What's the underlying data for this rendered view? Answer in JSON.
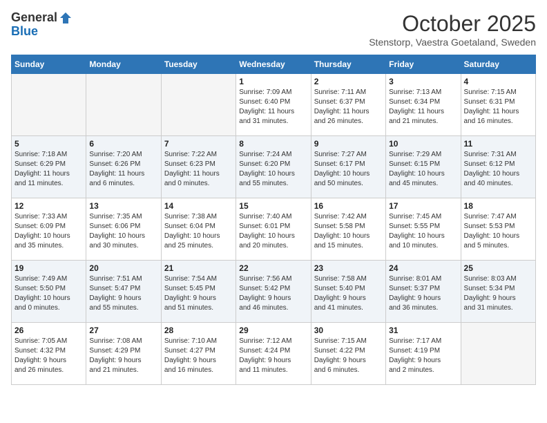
{
  "logo": {
    "general": "General",
    "blue": "Blue"
  },
  "title": "October 2025",
  "location": "Stenstorp, Vaestra Goetaland, Sweden",
  "weekdays": [
    "Sunday",
    "Monday",
    "Tuesday",
    "Wednesday",
    "Thursday",
    "Friday",
    "Saturday"
  ],
  "weeks": [
    [
      {
        "day": "",
        "info": ""
      },
      {
        "day": "",
        "info": ""
      },
      {
        "day": "",
        "info": ""
      },
      {
        "day": "1",
        "info": "Sunrise: 7:09 AM\nSunset: 6:40 PM\nDaylight: 11 hours\nand 31 minutes."
      },
      {
        "day": "2",
        "info": "Sunrise: 7:11 AM\nSunset: 6:37 PM\nDaylight: 11 hours\nand 26 minutes."
      },
      {
        "day": "3",
        "info": "Sunrise: 7:13 AM\nSunset: 6:34 PM\nDaylight: 11 hours\nand 21 minutes."
      },
      {
        "day": "4",
        "info": "Sunrise: 7:15 AM\nSunset: 6:31 PM\nDaylight: 11 hours\nand 16 minutes."
      }
    ],
    [
      {
        "day": "5",
        "info": "Sunrise: 7:18 AM\nSunset: 6:29 PM\nDaylight: 11 hours\nand 11 minutes."
      },
      {
        "day": "6",
        "info": "Sunrise: 7:20 AM\nSunset: 6:26 PM\nDaylight: 11 hours\nand 6 minutes."
      },
      {
        "day": "7",
        "info": "Sunrise: 7:22 AM\nSunset: 6:23 PM\nDaylight: 11 hours\nand 0 minutes."
      },
      {
        "day": "8",
        "info": "Sunrise: 7:24 AM\nSunset: 6:20 PM\nDaylight: 10 hours\nand 55 minutes."
      },
      {
        "day": "9",
        "info": "Sunrise: 7:27 AM\nSunset: 6:17 PM\nDaylight: 10 hours\nand 50 minutes."
      },
      {
        "day": "10",
        "info": "Sunrise: 7:29 AM\nSunset: 6:15 PM\nDaylight: 10 hours\nand 45 minutes."
      },
      {
        "day": "11",
        "info": "Sunrise: 7:31 AM\nSunset: 6:12 PM\nDaylight: 10 hours\nand 40 minutes."
      }
    ],
    [
      {
        "day": "12",
        "info": "Sunrise: 7:33 AM\nSunset: 6:09 PM\nDaylight: 10 hours\nand 35 minutes."
      },
      {
        "day": "13",
        "info": "Sunrise: 7:35 AM\nSunset: 6:06 PM\nDaylight: 10 hours\nand 30 minutes."
      },
      {
        "day": "14",
        "info": "Sunrise: 7:38 AM\nSunset: 6:04 PM\nDaylight: 10 hours\nand 25 minutes."
      },
      {
        "day": "15",
        "info": "Sunrise: 7:40 AM\nSunset: 6:01 PM\nDaylight: 10 hours\nand 20 minutes."
      },
      {
        "day": "16",
        "info": "Sunrise: 7:42 AM\nSunset: 5:58 PM\nDaylight: 10 hours\nand 15 minutes."
      },
      {
        "day": "17",
        "info": "Sunrise: 7:45 AM\nSunset: 5:55 PM\nDaylight: 10 hours\nand 10 minutes."
      },
      {
        "day": "18",
        "info": "Sunrise: 7:47 AM\nSunset: 5:53 PM\nDaylight: 10 hours\nand 5 minutes."
      }
    ],
    [
      {
        "day": "19",
        "info": "Sunrise: 7:49 AM\nSunset: 5:50 PM\nDaylight: 10 hours\nand 0 minutes."
      },
      {
        "day": "20",
        "info": "Sunrise: 7:51 AM\nSunset: 5:47 PM\nDaylight: 9 hours\nand 55 minutes."
      },
      {
        "day": "21",
        "info": "Sunrise: 7:54 AM\nSunset: 5:45 PM\nDaylight: 9 hours\nand 51 minutes."
      },
      {
        "day": "22",
        "info": "Sunrise: 7:56 AM\nSunset: 5:42 PM\nDaylight: 9 hours\nand 46 minutes."
      },
      {
        "day": "23",
        "info": "Sunrise: 7:58 AM\nSunset: 5:40 PM\nDaylight: 9 hours\nand 41 minutes."
      },
      {
        "day": "24",
        "info": "Sunrise: 8:01 AM\nSunset: 5:37 PM\nDaylight: 9 hours\nand 36 minutes."
      },
      {
        "day": "25",
        "info": "Sunrise: 8:03 AM\nSunset: 5:34 PM\nDaylight: 9 hours\nand 31 minutes."
      }
    ],
    [
      {
        "day": "26",
        "info": "Sunrise: 7:05 AM\nSunset: 4:32 PM\nDaylight: 9 hours\nand 26 minutes."
      },
      {
        "day": "27",
        "info": "Sunrise: 7:08 AM\nSunset: 4:29 PM\nDaylight: 9 hours\nand 21 minutes."
      },
      {
        "day": "28",
        "info": "Sunrise: 7:10 AM\nSunset: 4:27 PM\nDaylight: 9 hours\nand 16 minutes."
      },
      {
        "day": "29",
        "info": "Sunrise: 7:12 AM\nSunset: 4:24 PM\nDaylight: 9 hours\nand 11 minutes."
      },
      {
        "day": "30",
        "info": "Sunrise: 7:15 AM\nSunset: 4:22 PM\nDaylight: 9 hours\nand 6 minutes."
      },
      {
        "day": "31",
        "info": "Sunrise: 7:17 AM\nSunset: 4:19 PM\nDaylight: 9 hours\nand 2 minutes."
      },
      {
        "day": "",
        "info": ""
      }
    ]
  ]
}
